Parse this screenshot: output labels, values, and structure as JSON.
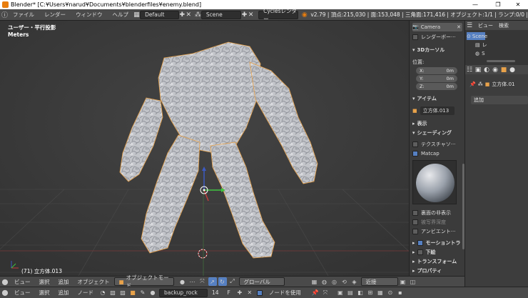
{
  "window": {
    "title": "Blender* [C:¥Users¥narud¥Documents¥blenderfiles¥enemy.blend]",
    "controls": [
      "—",
      "❐",
      "✕"
    ]
  },
  "topbar": {
    "menus": [
      "ファイル",
      "レンダー",
      "ウィンドウ",
      "ヘルプ"
    ],
    "screen_layout": "Default",
    "scene": "Scene",
    "render_engine": "Cyclesレンダー",
    "stats": "v2.79 | 頂点:215,030 | 面:153,048 | 三角面:171,416 | オブジェクト:1/1 | ランプ:0/0 |"
  },
  "viewport": {
    "view_label": "ユーザー・平行投影",
    "units_label": "Meters",
    "object_label": "(71) 立方体.013"
  },
  "npanel": {
    "camera_label": "Camera",
    "render_border_label": "レンダーボー···",
    "cursor_section": "3Dカーソル",
    "location_label": "位置:",
    "x_label": "X:",
    "x_value": "0m",
    "y_label": "Y:",
    "y_value": "0m",
    "z_label": "Z:",
    "z_value": "0m",
    "item_section": "アイテム",
    "item_name": "立方体.013",
    "display_section": "表示",
    "shading_section": "シェーディング",
    "textured_solid_label": "テクスチャソ···",
    "matcap_label": "Matcap",
    "backface_culling_label": "裏面の非表示",
    "depth_of_field_label": "被写界深度",
    "ambient_occlusion_label": "アンビエント···",
    "motion_tracking_section": "モーショントラ",
    "background_images_section": "下絵",
    "transform_orientations_section": "トランスフォーム",
    "properties_section": "プロパティ"
  },
  "outliner": {
    "view_label": "ビュー",
    "search_label": "検索",
    "scene_label": "Scene",
    "layer_label": "レ",
    "world_label": "S"
  },
  "properties": {
    "object_name": "立方体.01",
    "add_label": "追加"
  },
  "bar3d": {
    "view_label": "ビュー",
    "select_label": "選択",
    "add_label": "追加",
    "object_label": "オブジェクト",
    "mode_label": "オブジェクトモード",
    "orientation_label": "グローバル",
    "snap_label": "近接"
  },
  "barnode": {
    "view_label": "ビュー",
    "select_label": "選択",
    "add_label": "追加",
    "node_label": "ノード",
    "material_name": "backup_rock",
    "user_count": "14",
    "fake_user": "F",
    "use_nodes_label": "ノードを使用"
  },
  "colors": {
    "accent": "#5680c2",
    "object_orange": "#e8a24a",
    "axis_x": "#c23c3c",
    "axis_y": "#5bb23c",
    "axis_z": "#3c5ac2",
    "mesh_grey": "#c4c6cb"
  }
}
